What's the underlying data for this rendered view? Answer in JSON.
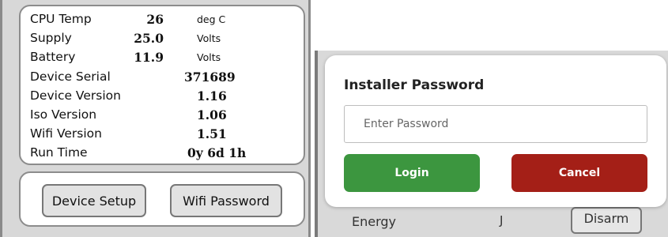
{
  "device_info": {
    "rows": [
      {
        "label": "CPU Temp",
        "value": "26",
        "unit": "deg C"
      },
      {
        "label": "Supply",
        "value": "25.0",
        "unit": "Volts"
      },
      {
        "label": "Battery",
        "value": "11.9",
        "unit": "Volts"
      },
      {
        "label": "Device Serial",
        "value": "371689"
      },
      {
        "label": "Device Version",
        "value": "1.16"
      },
      {
        "label": "Iso Version",
        "value": "1.06"
      },
      {
        "label": "Wifi Version",
        "value": "1.51"
      },
      {
        "label": "Run Time",
        "value": "0y 6d 1h"
      }
    ]
  },
  "device_buttons": {
    "setup_label": "Device Setup",
    "wifi_label": "Wifi Password"
  },
  "background": {
    "energy_label": "Energy",
    "energy_unit": "J",
    "disarm_label": "Disarm"
  },
  "modal": {
    "title": "Installer Password",
    "password_placeholder": "Enter Password",
    "login_label": "Login",
    "cancel_label": "Cancel"
  },
  "colors": {
    "login": "#3c963f",
    "cancel": "#a41f17"
  }
}
